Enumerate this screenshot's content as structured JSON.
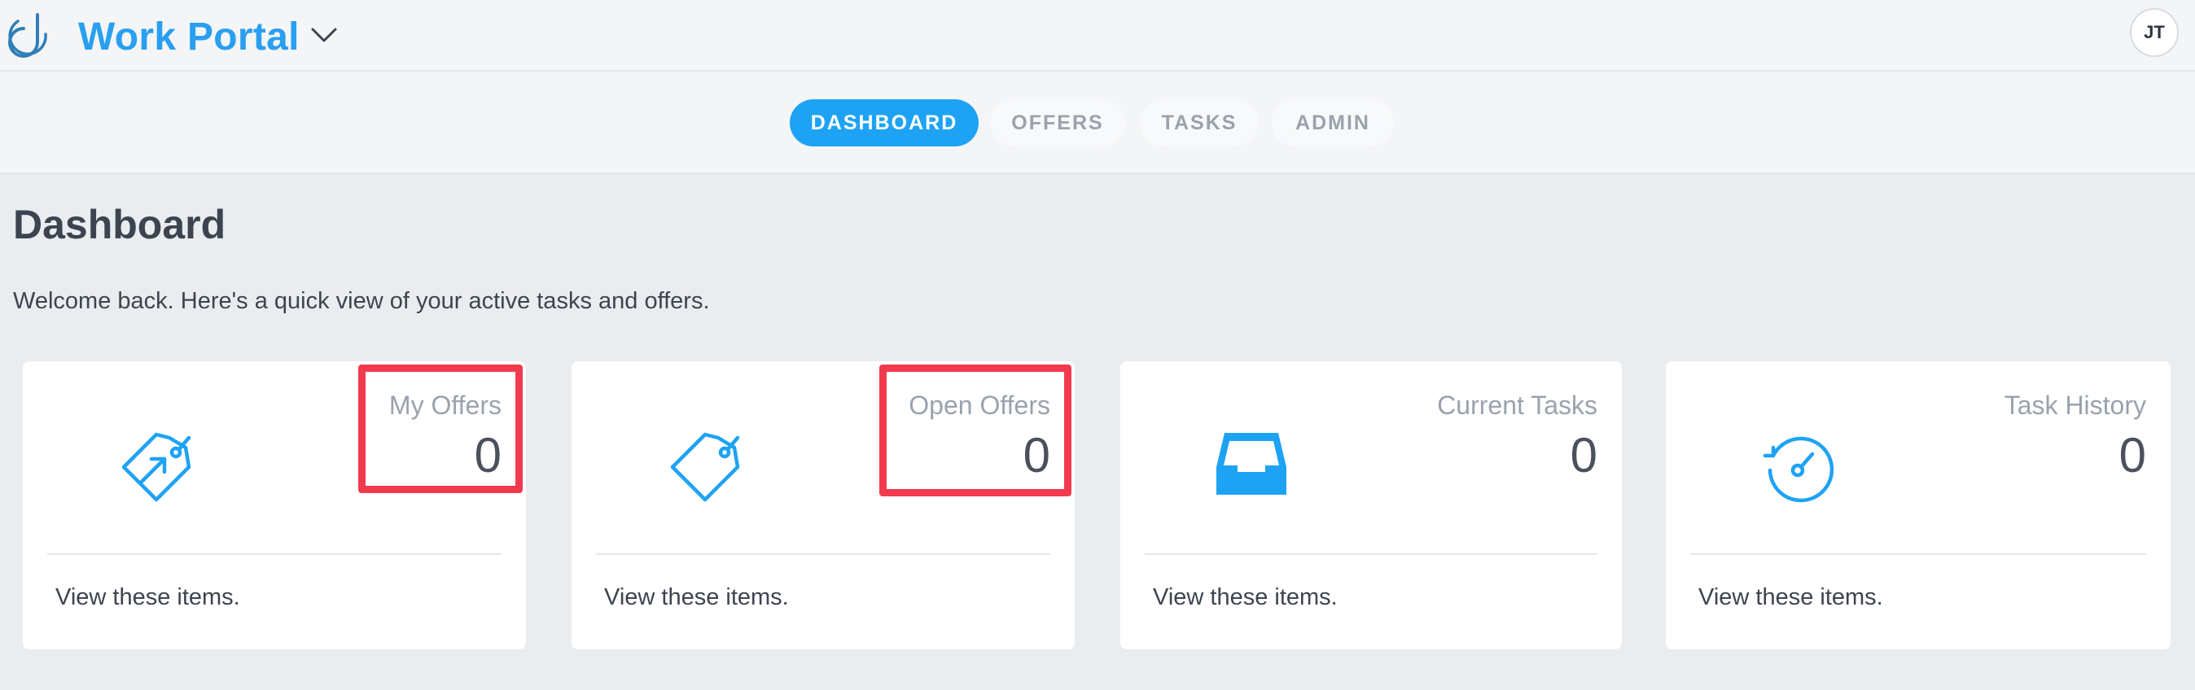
{
  "header": {
    "app_title": "Work Portal",
    "app_switcher_icon": "chevron-down-icon",
    "logo_icon": "app-logo-icon",
    "avatar_initials": "JT"
  },
  "nav": {
    "tabs": [
      {
        "label": "DASHBOARD",
        "active": true
      },
      {
        "label": "OFFERS",
        "active": false
      },
      {
        "label": "TASKS",
        "active": false
      },
      {
        "label": "ADMIN",
        "active": false
      }
    ]
  },
  "main": {
    "title": "Dashboard",
    "welcome": "Welcome back. Here's a quick view of your active tasks and offers."
  },
  "cards": [
    {
      "title": "My Offers",
      "count": "0",
      "link": "View these items.",
      "icon": "tag-arrow-icon",
      "highlighted": true
    },
    {
      "title": "Open Offers",
      "count": "0",
      "link": "View these items.",
      "icon": "tag-icon",
      "highlighted": true
    },
    {
      "title": "Current Tasks",
      "count": "0",
      "link": "View these items.",
      "icon": "inbox-tray-icon",
      "highlighted": false
    },
    {
      "title": "Task History",
      "count": "0",
      "link": "View these items.",
      "icon": "history-clock-icon",
      "highlighted": false
    }
  ],
  "colors": {
    "accent": "#1ea3f4",
    "title_blue": "#2a9ff0",
    "highlight_red": "#f23a4e",
    "background": "#eaedf0"
  }
}
